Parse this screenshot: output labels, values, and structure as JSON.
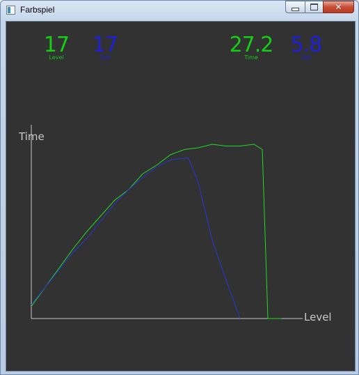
{
  "window": {
    "title": "Farbspiel",
    "close_glyph": "✕"
  },
  "stats": {
    "player1_level": {
      "value": "17",
      "label": "Level"
    },
    "player2_level": {
      "value": "17",
      "label": "Zeit"
    },
    "player1_time": {
      "value": "27.2",
      "label": "Time"
    },
    "player2_time": {
      "value": "5.8",
      "label": "Zeit"
    }
  },
  "chart": {
    "y_axis_label": "Time",
    "x_axis_label": "Level"
  },
  "colors": {
    "background": "#323232",
    "series_green": "#22dd22",
    "series_blue": "#2a35d6",
    "axis": "#c8c8c8"
  },
  "chart_data": {
    "type": "line",
    "xlabel": "Level",
    "ylabel": "Time",
    "grid": false,
    "xlim": [
      0,
      20
    ],
    "ylim": [
      0,
      100
    ],
    "series": [
      {
        "color": "#22dd22",
        "x": [
          0,
          1,
          2,
          3,
          4,
          5,
          6,
          7,
          8,
          9,
          10,
          11,
          12,
          13,
          14,
          15,
          16,
          16.6,
          17,
          18
        ],
        "y": [
          7,
          18,
          29,
          40,
          50,
          59,
          68,
          74,
          83,
          88,
          94,
          97,
          98,
          100,
          99,
          99,
          100,
          97,
          0,
          0
        ]
      },
      {
        "color": "#2a35d6",
        "x": [
          0,
          1,
          2,
          3,
          4,
          5,
          6,
          7,
          8,
          9,
          10,
          11,
          11.3,
          12,
          13,
          14,
          15
        ],
        "y": [
          8,
          18,
          28,
          38,
          46,
          56,
          66,
          74,
          81,
          87,
          91,
          92,
          92,
          78,
          45,
          22,
          0
        ]
      }
    ]
  }
}
